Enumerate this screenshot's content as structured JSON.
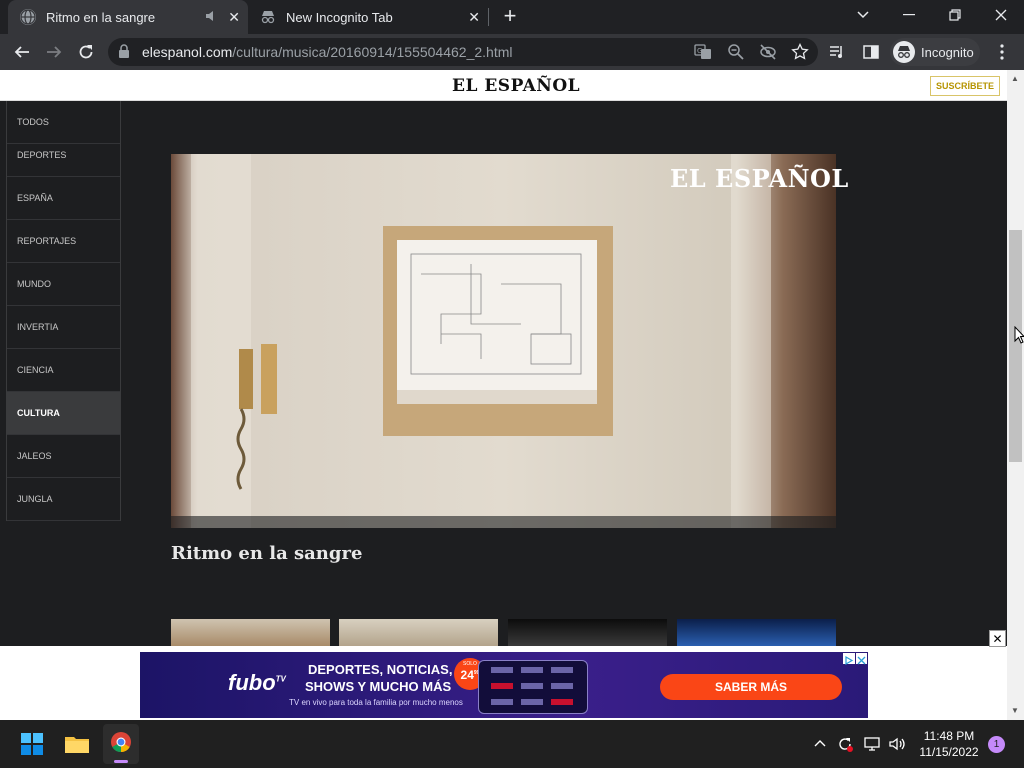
{
  "tabs": [
    {
      "title": "Ritmo en la sangre",
      "active": true,
      "icon": "globe-icon"
    },
    {
      "title": "New Incognito Tab",
      "active": false,
      "icon": "incognito-icon"
    }
  ],
  "window_controls": {
    "dropdown": "⌄",
    "minimize": "—",
    "restore": "❐",
    "close": "✕"
  },
  "address_bar": {
    "domain": "elespanol.com",
    "path": "/cultura/musica/20160914/155504462_2.html"
  },
  "profile": {
    "label": "Incognito"
  },
  "site": {
    "logo": "EL ESPAÑOL",
    "subscribe": "SUSCRÍBETE",
    "menu": [
      "TODOS",
      "DEPORTES",
      "ESPAÑA",
      "REPORTAJES",
      "MUNDO",
      "INVERTIA",
      "CIENCIA",
      "CULTURA",
      "JALEOS",
      "JUNGLA"
    ],
    "active_menu": "CULTURA",
    "video_watermark": "EL ESPAÑOL",
    "video_title": "Ritmo en la sangre"
  },
  "ad": {
    "brand": "fubo",
    "brand_tv": "TV",
    "headline_1": "DEPORTES, NOTICIAS,",
    "headline_2": "SHOWS Y MUCHO MÁS",
    "subline": "TV en vivo para toda la familia por mucho menos",
    "badge_top": "SOLO",
    "badge_price": "24",
    "badge_suffix": "99",
    "cta": "SABER MÁS",
    "close": "✕"
  },
  "taskbar": {
    "time": "11:48 PM",
    "date": "11/15/2022",
    "notifications": "1"
  },
  "colors": {
    "chrome_dark": "#202124",
    "toolbar": "#35363a",
    "page_bg": "#1d1e20",
    "ad_cta": "#fa4616",
    "subscribe_gold": "#b69400"
  }
}
